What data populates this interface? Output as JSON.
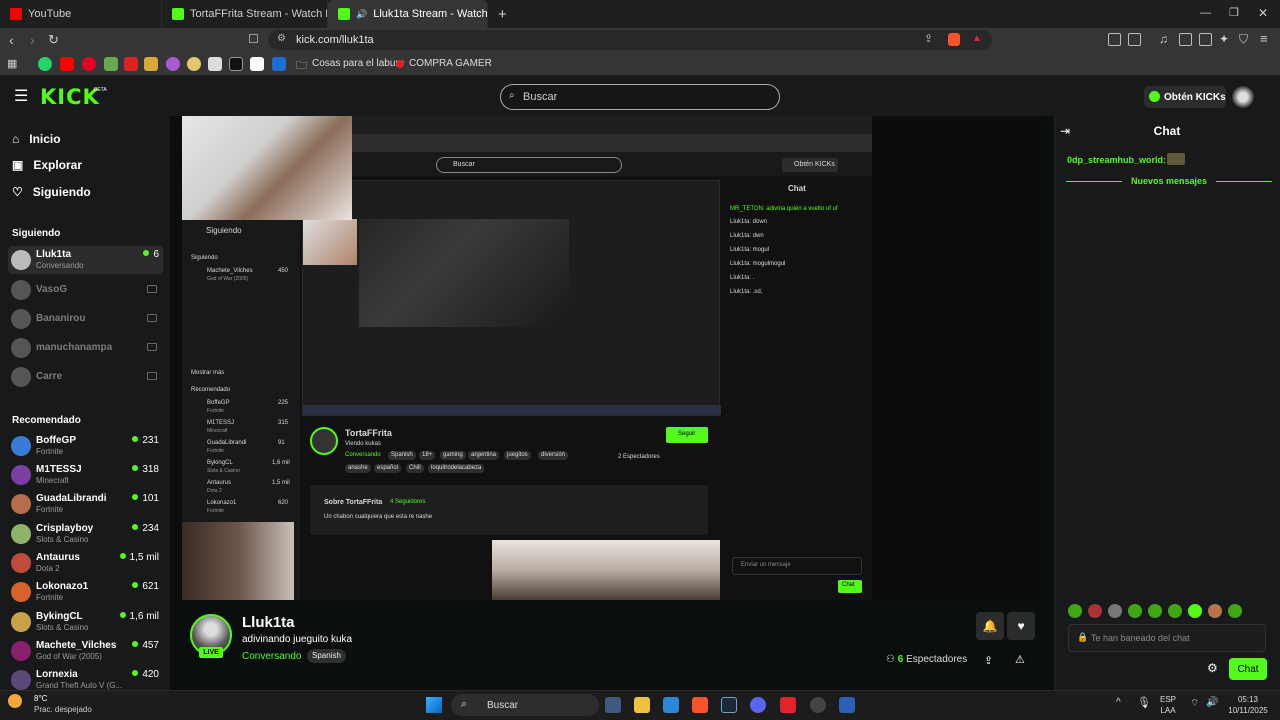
{
  "browser": {
    "tabs": [
      {
        "label": "YouTube",
        "icon": "youtube-icon"
      },
      {
        "label": "TortaFFrita Stream - Watch Live on K",
        "icon": "kick-icon"
      },
      {
        "label": "Lluk1ta Stream - Watch Live o",
        "icon": "kick-icon"
      }
    ],
    "url": "kick.com/lluk1ta",
    "bookmarks": [
      "Cosas para el laburo",
      "COMPRA GAMER"
    ]
  },
  "header": {
    "logo": "KICK",
    "beta": "BETA",
    "search_placeholder": "Buscar",
    "get_kicks": "Obtén KICKs"
  },
  "sidebar": {
    "nav": [
      {
        "label": "Inicio",
        "icon": "home-icon"
      },
      {
        "label": "Explorar",
        "icon": "compass-icon"
      },
      {
        "label": "Siguiendo",
        "icon": "heart-icon"
      }
    ],
    "following_title": "Siguiendo",
    "following": [
      {
        "name": "Lluk1ta",
        "sub": "Conversando",
        "viewers": "6",
        "live": true
      },
      {
        "name": "VasoG",
        "live": false
      },
      {
        "name": "Bananirou",
        "live": false
      },
      {
        "name": "manuchanampa",
        "live": false
      },
      {
        "name": "Carre",
        "live": false
      }
    ],
    "recommended_title": "Recomendado",
    "recommended": [
      {
        "name": "BoffeGP",
        "sub": "Fortnite",
        "viewers": "231"
      },
      {
        "name": "M1TESSJ",
        "sub": "Minecraft",
        "viewers": "318"
      },
      {
        "name": "GuadaLibrandi",
        "sub": "Fortnite",
        "viewers": "101"
      },
      {
        "name": "Crisplayboy",
        "sub": "Slots & Casino",
        "viewers": "234"
      },
      {
        "name": "Antaurus",
        "sub": "Dota 2",
        "viewers": "1,5 mil"
      },
      {
        "name": "Lokonazo1",
        "sub": "Fortnite",
        "viewers": "621"
      },
      {
        "name": "BykingCL",
        "sub": "Slots & Casino",
        "viewers": "1,6 mil"
      },
      {
        "name": "Machete_Vilches",
        "sub": "God of War (2005)",
        "viewers": "457"
      },
      {
        "name": "Lornexia",
        "sub": "Grand Theft Auto V (G...",
        "viewers": "420"
      }
    ]
  },
  "video_inner": {
    "search": "Buscar",
    "get_kicks": "Obtén KICKs",
    "chat_title": "Chat",
    "following": "Siguiendo",
    "following_head": "Siguiendo",
    "recommended_head": "Recomendado",
    "mostrar_mas": "Mostrar más",
    "chat_lines": [
      "MR_TETON: adivina quién a vuelto uf uf",
      "Lluk1ta: down",
      "Lluk1ta: dwn",
      "Lluk1ta: mogul",
      "Lluk1ta: mogulmogul",
      "Lluk1ta: .",
      "Lluk1ta: .sd,"
    ],
    "streamer": "TortaFFrita",
    "streamer_title": "Viendo kukas",
    "streamer_cat": "Conversando",
    "tags": [
      "Spanish",
      "18+",
      "gaming",
      "argentina",
      "juegitos",
      "diversión",
      "anashe",
      "español",
      "Chill",
      "loquitrodelacabeza"
    ],
    "follow": "Seguir",
    "viewers": "2 Espectadores",
    "about_title": "Sobre TortaFFrita",
    "about_followers": "4 Seguidores",
    "about_text": "Un chabon cualquiera que esta re nashe",
    "send_placeholder": "Enviar un mensaje",
    "chat_button": "Chat",
    "inner_channels": [
      {
        "name": "Machete_Vilches",
        "sub": "God of War (2005)",
        "viewers": "450"
      },
      {
        "name": "BoffeGP",
        "sub": "Fortnite",
        "viewers": "225"
      },
      {
        "name": "M1TESSJ",
        "sub": "Minecraft",
        "viewers": "315"
      },
      {
        "name": "GuadaLibrandi",
        "sub": "Fortnite",
        "viewers": "91"
      },
      {
        "name": "BykingCL",
        "sub": "Slots & Casino",
        "viewers": "1,6 mil"
      },
      {
        "name": "Antaurus",
        "sub": "Dota 2",
        "viewers": "1,5 mil"
      },
      {
        "name": "Lokonazo1",
        "sub": "Fortnite",
        "viewers": "620"
      }
    ]
  },
  "stream": {
    "name": "Lluk1ta",
    "title": "adivinando jueguito kuka",
    "category": "Conversando",
    "language": "Spanish",
    "live": "LIVE",
    "viewers_count": "6",
    "viewers_label": "Espectadores"
  },
  "chat": {
    "title": "Chat",
    "user": "0dp_streamhub_world:",
    "new_messages": "Nuevos mensajes",
    "banned": "Te han baneado del chat",
    "send": "Chat"
  },
  "taskbar": {
    "weather_temp": "8°C",
    "weather_desc": "Prac. despejado",
    "search": "Buscar",
    "lang": "ESP",
    "lang2": "LAA",
    "time": "05:13",
    "date": "10/11/2025"
  },
  "colors": {
    "accent": "#53fc18",
    "bg": "#0b0e0f",
    "panel": "#18191b"
  }
}
